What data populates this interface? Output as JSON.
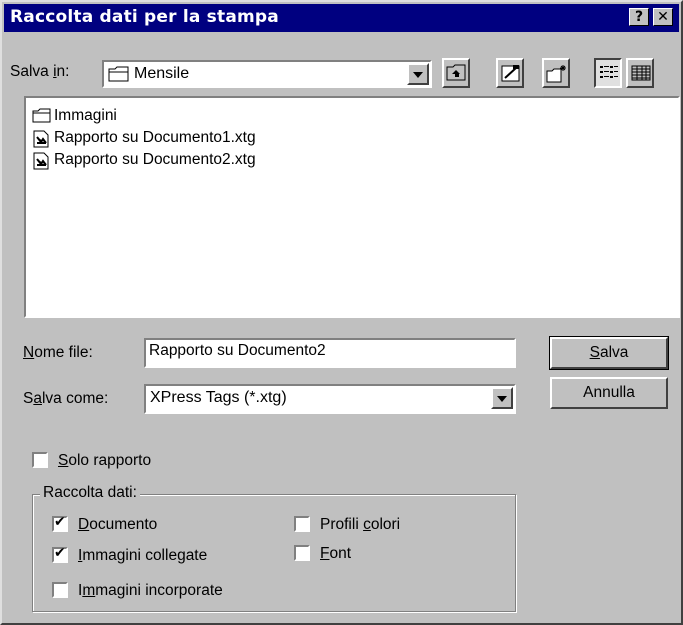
{
  "window": {
    "title": "Raccolta dati per la stampa",
    "help_glyph": "?",
    "close_glyph": "✕"
  },
  "save_in": {
    "label_pre": "Salva ",
    "label_ul": "i",
    "label_post": "n:",
    "value": "Mensile",
    "icon": "folder-icon"
  },
  "toolbar": {
    "up_icon": "up-folder-icon",
    "desktop_icon": "desktop-icon",
    "new_folder_icon": "new-folder-icon",
    "list_icon": "list-view-icon",
    "details_icon": "details-view-icon"
  },
  "files": [
    {
      "name": "Immagini",
      "icon": "folder-icon"
    },
    {
      "name": "Rapporto su Documento1.xtg",
      "icon": "document-icon"
    },
    {
      "name": "Rapporto su Documento2.xtg",
      "icon": "document-icon"
    }
  ],
  "filename": {
    "label_ul": "N",
    "label_post": "ome file:",
    "value": "Rapporto su Documento2"
  },
  "save_as": {
    "label_pre": "S",
    "label_ul": "a",
    "label_post": "lva come:",
    "value": "XPress Tags (*.xtg)"
  },
  "buttons": {
    "save_ul": "S",
    "save_post": "alva",
    "cancel": "Annulla"
  },
  "report_only": {
    "label_ul": "S",
    "label_post": "olo rapporto",
    "checked": false
  },
  "group": {
    "title": "Raccolta dati:",
    "document": {
      "label_ul": "D",
      "label_post": "ocumento",
      "checked": true
    },
    "linked_images": {
      "label_ul": "I",
      "label_post": "mmagini collegate",
      "checked": true
    },
    "embedded_images": {
      "label_pre": "I",
      "label_ul": "m",
      "label_post": "magini incorporate",
      "checked": false
    },
    "color_profiles": {
      "label_pre": "Profili ",
      "label_ul": "c",
      "label_post": "olori",
      "checked": false
    },
    "font": {
      "label_ul": "F",
      "label_post": "ont",
      "checked": false
    }
  },
  "check_glyph": "✔"
}
